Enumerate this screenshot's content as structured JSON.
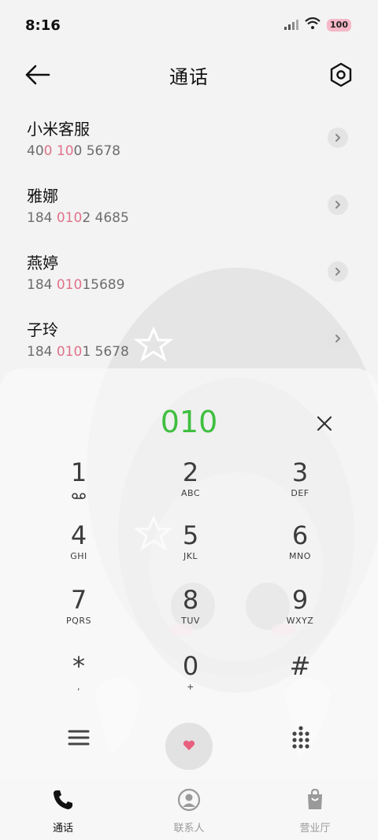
{
  "status_bar": {
    "time": "8:16",
    "battery": "100"
  },
  "header": {
    "title": "通话"
  },
  "contacts": [
    {
      "name": "小米客服",
      "number_parts": [
        "40",
        "0",
        " ",
        "10",
        "0 5678"
      ]
    },
    {
      "name": "雅娜",
      "number_parts": [
        "184 ",
        "010",
        "2 4685",
        "",
        ""
      ]
    },
    {
      "name": "燕婷",
      "number_parts": [
        "184 ",
        "010",
        "15689",
        "",
        ""
      ]
    },
    {
      "name": "子玲",
      "number_parts": [
        "184 ",
        "010",
        "1 5678",
        "",
        ""
      ]
    }
  ],
  "dialer": {
    "display": "010",
    "keys": [
      {
        "digit": "1",
        "letters": ""
      },
      {
        "digit": "2",
        "letters": "ABC"
      },
      {
        "digit": "3",
        "letters": "DEF"
      },
      {
        "digit": "4",
        "letters": "GHI"
      },
      {
        "digit": "5",
        "letters": "JKL"
      },
      {
        "digit": "6",
        "letters": "MNO"
      },
      {
        "digit": "7",
        "letters": "PQRS"
      },
      {
        "digit": "8",
        "letters": "TUV"
      },
      {
        "digit": "9",
        "letters": "WXYZ"
      },
      {
        "digit": "*",
        "letters": ","
      },
      {
        "digit": "0",
        "letters": "+"
      },
      {
        "digit": "#",
        "letters": ""
      }
    ]
  },
  "bottom_nav": [
    {
      "label": "通话",
      "icon": "phone-icon",
      "active": true
    },
    {
      "label": "联系人",
      "icon": "contact-icon",
      "active": false
    },
    {
      "label": "营业厅",
      "icon": "shopping-bag-icon",
      "active": false
    }
  ],
  "colors": {
    "accent_green": "#3fbf3f",
    "highlight_pink": "#e0738a"
  }
}
